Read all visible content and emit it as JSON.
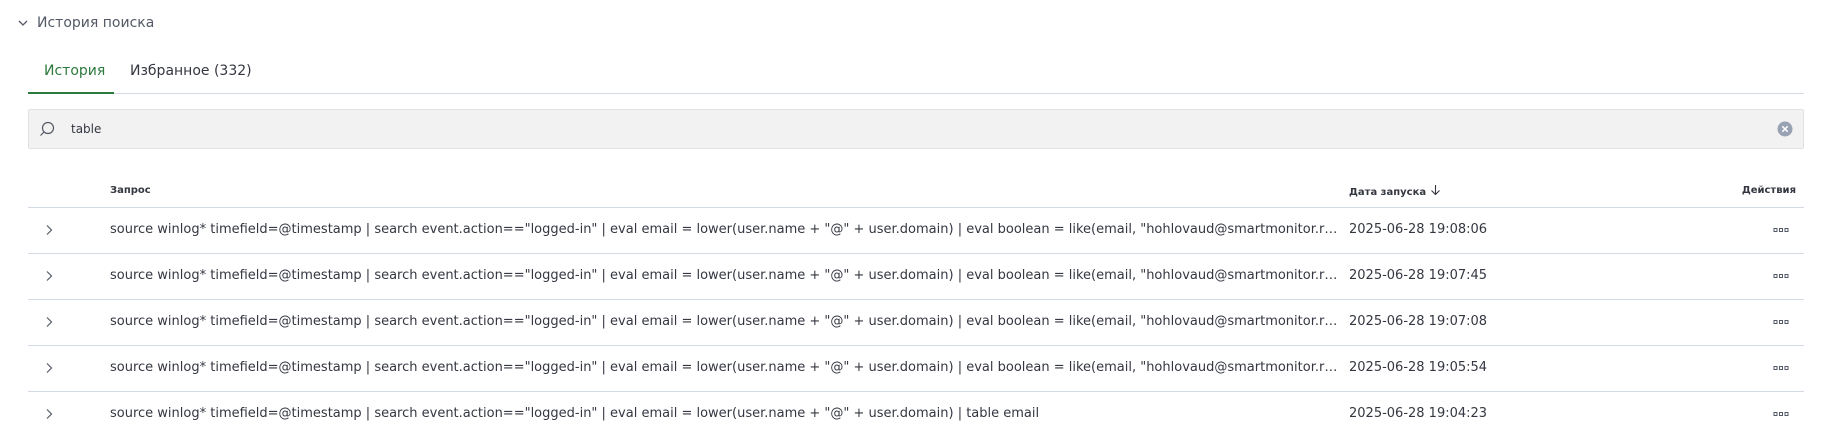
{
  "section": {
    "title": "История поиска"
  },
  "tabs": [
    {
      "label": "История"
    },
    {
      "label": "Избранное (332)"
    }
  ],
  "search": {
    "value": "table"
  },
  "table": {
    "headers": {
      "query": "Запрос",
      "date": "Дата запуска",
      "actions": "Действия"
    },
    "rows": [
      {
        "query": "source winlog* timefield=@timestamp | search event.action==\"logged-in\" | eval email = lower(user.name + \"@\" + user.domain) | eval boolean = like(email, \"hohlovaud@smartmonitor.ru\") | eva...",
        "date": "2025-06-28 19:08:06"
      },
      {
        "query": "source winlog* timefield=@timestamp | search event.action==\"logged-in\" | eval email = lower(user.name + \"@\" + user.domain) | eval boolean = like(email, \"hohlovaud@smartmonitor.ru\") | eva...",
        "date": "2025-06-28 19:07:45"
      },
      {
        "query": "source winlog* timefield=@timestamp | search event.action==\"logged-in\" | eval email = lower(user.name + \"@\" + user.domain) | eval boolean = like(email, \"hohlovaud@smartmonitor.ru\") | eva...",
        "date": "2025-06-28 19:07:08"
      },
      {
        "query": "source winlog* timefield=@timestamp | search event.action==\"logged-in\" | eval email = lower(user.name + \"@\" + user.domain) | eval boolean = like(email, \"hohlovaud@smartmonitor.ru\") | eva...",
        "date": "2025-06-28 19:05:54"
      },
      {
        "query": "source winlog* timefield=@timestamp | search event.action==\"logged-in\" | eval email = lower(user.name + \"@\" + user.domain) | table email",
        "date": "2025-06-28 19:04:23"
      }
    ]
  },
  "icons": {
    "collapse": "chevron-down-icon",
    "search": "search-icon",
    "clear": "clear-icon",
    "sort": "arrow-down-icon",
    "expand": "chevron-right-icon",
    "actions": "more-horizontal-icon"
  },
  "colors": {
    "accent": "#2d7a3e",
    "border": "#d3dae6",
    "search_bg": "#f1f2f1"
  }
}
